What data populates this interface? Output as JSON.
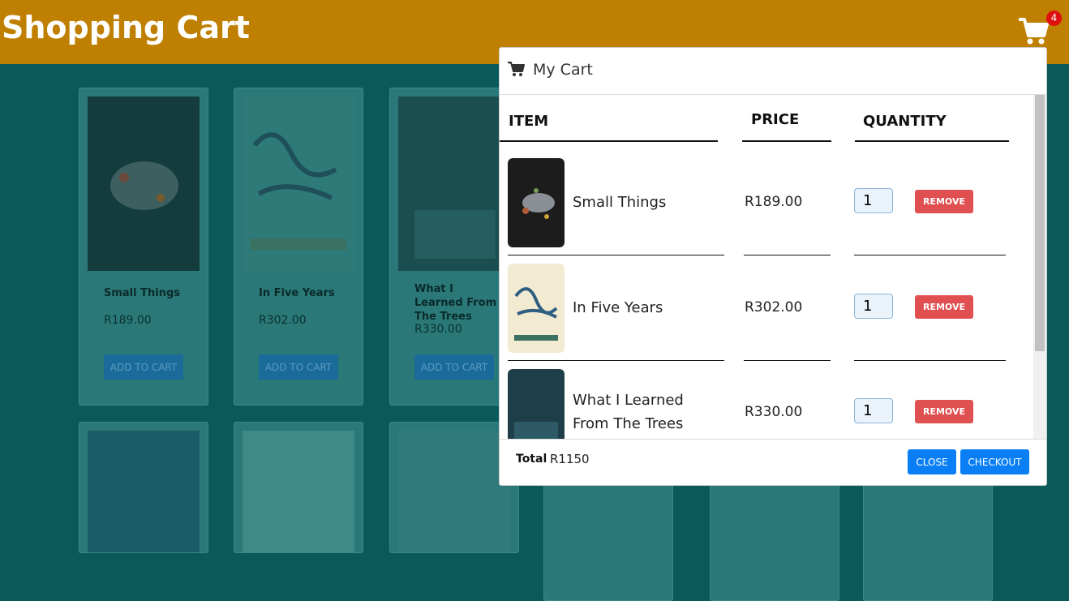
{
  "header": {
    "title": "Shopping Cart",
    "cart_count": "4"
  },
  "products": [
    {
      "title": "Small Things",
      "price": "R189.00",
      "button": "ADD TO CART"
    },
    {
      "title": "In Five Years",
      "price": "R302.00",
      "button": "ADD TO CART"
    },
    {
      "title": "What I Learned From The Trees",
      "price": "R330.00",
      "button": "ADD TO CART"
    }
  ],
  "modal": {
    "title": "My Cart",
    "columns": {
      "item": "ITEM",
      "price": "PRICE",
      "quantity": "QUANTITY"
    },
    "items": [
      {
        "name": "Small Things",
        "price": "R189.00",
        "qty": "1",
        "remove": "REMOVE"
      },
      {
        "name": "In Five Years",
        "price": "R302.00",
        "qty": "1",
        "remove": "REMOVE"
      },
      {
        "name": "What I Learned From The Trees",
        "price": "R330.00",
        "qty": "1",
        "remove": "REMOVE"
      }
    ],
    "total_label": "Total",
    "total_value": "R1150",
    "close_label": "CLOSE",
    "checkout_label": "CHECKOUT"
  },
  "colors": {
    "header": "#bf7f00",
    "background": "#0b5a5a",
    "remove": "#e05050",
    "primary": "#0a7ff5"
  }
}
